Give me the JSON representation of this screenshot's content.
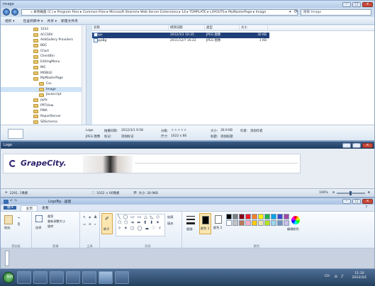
{
  "explorer": {
    "title": "Image",
    "address": "« 本地磁盘 (C:) ▸ Program Files ▸ Common Files ▸ Microsoft Shared ▸ Web Server Extensions ▸ 14 ▸ TEMPLATE ▸ LAYOUTS ▸ MyMasterPage ▸ Image",
    "search_placeholder": "搜索 Image",
    "toolbar": {
      "organize": "组织 ▾",
      "include": "包含到库中 ▾",
      "share": "共享 ▾",
      "new_folder": "新建文件夹"
    },
    "tree": [
      {
        "label": "1033"
      },
      {
        "label": "ACCSRV"
      },
      {
        "label": "AddGallery Providers"
      },
      {
        "label": "BDC"
      },
      {
        "label": "Chart"
      },
      {
        "label": "ClientBin"
      },
      {
        "label": "EditingMenu"
      },
      {
        "label": "INC"
      },
      {
        "label": "MOBILE"
      },
      {
        "label": "MyMasterPage"
      },
      {
        "label": "Css"
      },
      {
        "label": "Image"
      },
      {
        "label": "Javascript"
      },
      {
        "label": "pptx"
      },
      {
        "label": "PPTView"
      },
      {
        "label": "PWA"
      },
      {
        "label": "ReportServer"
      },
      {
        "label": "SDSchema"
      }
    ],
    "columns": {
      "name": "名称",
      "date": "修改日期",
      "type": "类型",
      "size": "大小"
    },
    "files": [
      {
        "name": "Logo",
        "date": "2012/3/1 10:35",
        "type": "JPEG 图像",
        "size": "30 KB"
      },
      {
        "name": "LogoBg",
        "date": "2011/12/7 16:22",
        "type": "JPEG 图像",
        "size": "1 KB"
      }
    ],
    "details": {
      "name": "Logo",
      "kind": "JPEG 图像",
      "date_label": "拍摄日期:",
      "date": "2012/3/1 9:58",
      "tag_label": "标记:",
      "tag": "添加标记",
      "rating_label": "分级:",
      "size_label": "大小:",
      "size": "30.9 KB",
      "dims_label": "尺寸:",
      "dims": "1022 x 66",
      "author_label": "作者:",
      "author": "添加作者",
      "title_label": "标题:",
      "title": "添加标题"
    }
  },
  "viewer": {
    "title": "Logo",
    "logo_text": "GrapeCity.",
    "status_left": "2291, 1像素",
    "status_dims": "1022 × 66像素",
    "status_size": "大小: 30.9KB",
    "zoom": "100%"
  },
  "paint": {
    "title": "LogoBg - 画图",
    "tabs": [
      "主页",
      "查看"
    ],
    "groups": [
      "剪贴板",
      "图像",
      "工具",
      "形状",
      "颜色"
    ],
    "labels": {
      "paste": "粘贴",
      "select": "选择",
      "crop": "裁剪",
      "resize": "重新调整大小",
      "rotate": "旋转",
      "brush": "刷子",
      "outline": "轮廓",
      "fill": "填充",
      "size": "粗细",
      "color1": "颜色 1",
      "color2": "颜色 2",
      "edit_colors": "编辑颜色"
    },
    "palette": [
      "#000000",
      "#7f7f7f",
      "#880015",
      "#ed1c24",
      "#ff7f27",
      "#fff200",
      "#22b14c",
      "#00a2e8",
      "#3f48cc",
      "#a349a4",
      "#ffffff",
      "#c3c3c3",
      "#b97a57",
      "#ffaec9",
      "#ffc90e",
      "#efe4b0",
      "#b5e61d",
      "#99d9ea",
      "#7092be",
      "#c8bfe7"
    ]
  },
  "taskbar": {
    "start_label": "开始",
    "time": "11:10",
    "date": "2012/3/1",
    "lang": "CH"
  }
}
